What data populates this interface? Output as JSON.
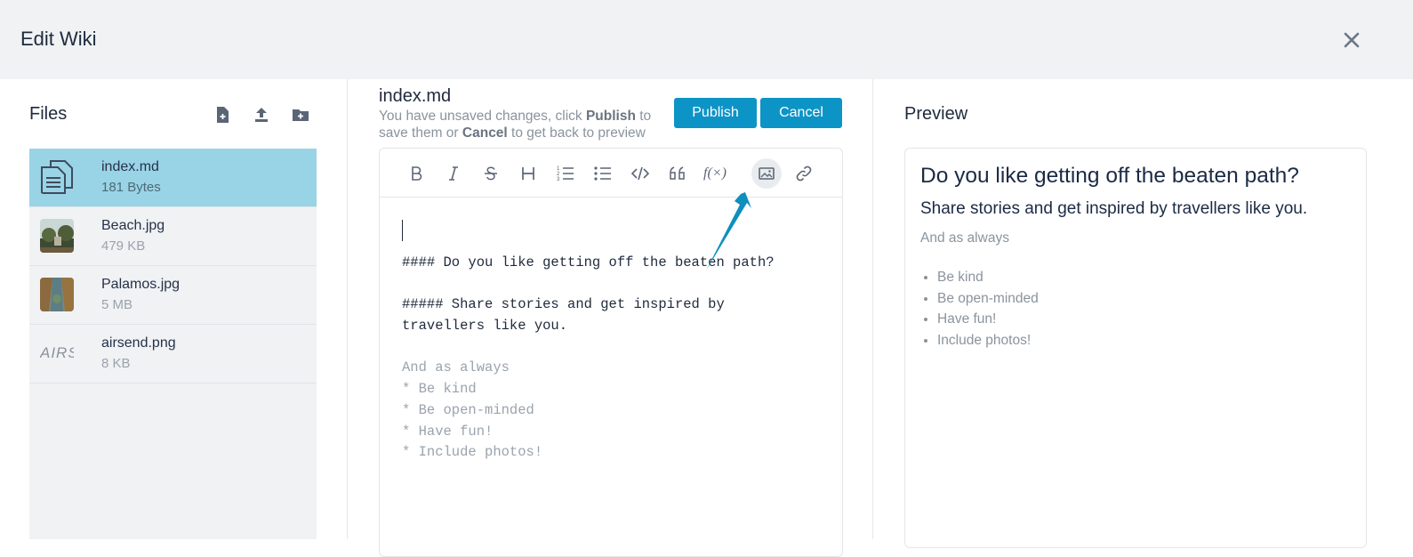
{
  "header": {
    "title": "Edit Wiki",
    "close_icon": "close-icon"
  },
  "files": {
    "title": "Files",
    "actions": [
      "new-file-icon",
      "upload-icon",
      "new-folder-icon"
    ],
    "items": [
      {
        "name": "index.md",
        "size": "181 Bytes",
        "thumb": "document-icon",
        "selected": true
      },
      {
        "name": "Beach.jpg",
        "size": "479 KB",
        "thumb": "beach-photo"
      },
      {
        "name": "Palamos.jpg",
        "size": "5 MB",
        "thumb": "palamos-photo"
      },
      {
        "name": "airsend.png",
        "size": "8 KB",
        "thumb": "airsend-logo",
        "thumb_text": "AIRS"
      }
    ]
  },
  "editor": {
    "filename": "index.md",
    "notice_pre": "You have unsaved changes, click ",
    "notice_publish": "Publish",
    "notice_mid": " to save them or ",
    "notice_cancel": "Cancel",
    "notice_post": " to get back to preview",
    "publish_label": "Publish",
    "cancel_label": "Cancel",
    "toolbar": [
      "bold-icon",
      "italic-icon",
      "strikethrough-icon",
      "heading-icon",
      "ordered-list-icon",
      "unordered-list-icon",
      "code-icon",
      "quote-icon",
      "formula-icon",
      "image-icon",
      "link-icon"
    ],
    "active_tool": "image-icon",
    "lines": [
      "#### Do you like getting off the beaten path?",
      "",
      "##### Share stories and get inspired by",
      "travellers like you.",
      "",
      "And as always",
      "* Be kind",
      "* Be open-minded",
      "* Have fun!",
      "* Include photos!"
    ]
  },
  "preview": {
    "title": "Preview",
    "h4": "Do you like getting off the beaten path?",
    "h5": "Share stories and get inspired by travellers like you.",
    "paragraph": "And as always",
    "list": [
      "Be kind",
      "Be open-minded",
      "Have fun!",
      "Include photos!"
    ]
  },
  "colors": {
    "accent": "#0d94c6",
    "selected_row": "#99d3e6",
    "header_bg": "#f0f2f4"
  }
}
